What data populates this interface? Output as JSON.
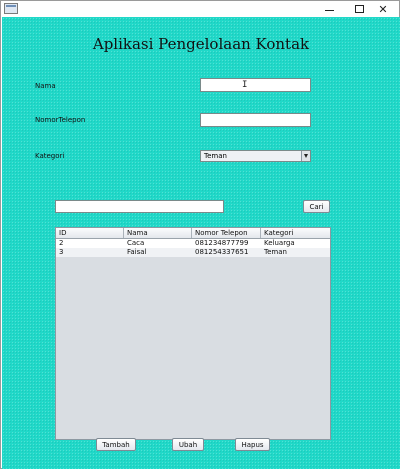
{
  "window": {
    "controls": {
      "minimize_icon": "minimize-icon",
      "maximize_icon": "maximize-icon",
      "close_icon": "close-icon",
      "close_glyph": "✕"
    }
  },
  "app_title": "Aplikasi Pengelolaan Kontak",
  "form": {
    "nama_label": "Nama",
    "nama_value": "",
    "telepon_label": "NomorTelepon",
    "telepon_value": "",
    "kategori_label": "Kategori",
    "kategori_selected": "Teman"
  },
  "search": {
    "value": "",
    "button_label": "Cari"
  },
  "table": {
    "columns": [
      "ID",
      "Nama",
      "Nomor Telepon",
      "Kategori"
    ],
    "rows": [
      [
        "2",
        "Caca",
        "081234877799",
        "Keluarga"
      ],
      [
        "3",
        "Faisal",
        "081254337651",
        "Teman"
      ]
    ]
  },
  "actions": {
    "tambah_label": "Tambah",
    "ubah_label": "Ubah",
    "hapus_label": "Hapus"
  },
  "colors": {
    "background": "#20d8c8"
  }
}
